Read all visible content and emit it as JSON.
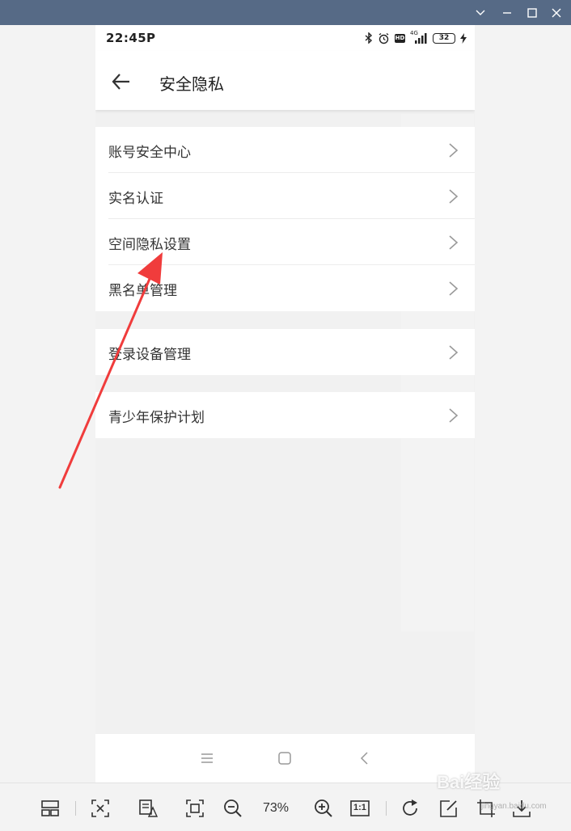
{
  "window": {
    "buttons": [
      "chevron-down",
      "minimize",
      "maximize",
      "close"
    ]
  },
  "status_bar": {
    "time": "22:45",
    "p_badge": "P",
    "hd": "HD",
    "network": "4G",
    "battery": "32"
  },
  "app_bar": {
    "title": "安全隐私"
  },
  "groups": [
    {
      "items": [
        {
          "label": "账号安全中心"
        },
        {
          "label": "实名认证"
        },
        {
          "label": "空间隐私设置"
        },
        {
          "label": "黑名单管理"
        }
      ]
    },
    {
      "items": [
        {
          "label": "登录设备管理"
        }
      ]
    },
    {
      "items": [
        {
          "label": "青少年保护计划"
        }
      ]
    }
  ],
  "toolbar": {
    "zoom": "73%",
    "one_to_one": "1:1"
  },
  "watermark": {
    "logo": "Bai经验",
    "sub": "jingyan.baidu.com"
  },
  "colors": {
    "titlebar": "#566a86",
    "annotation_arrow": "#f03c3c"
  }
}
